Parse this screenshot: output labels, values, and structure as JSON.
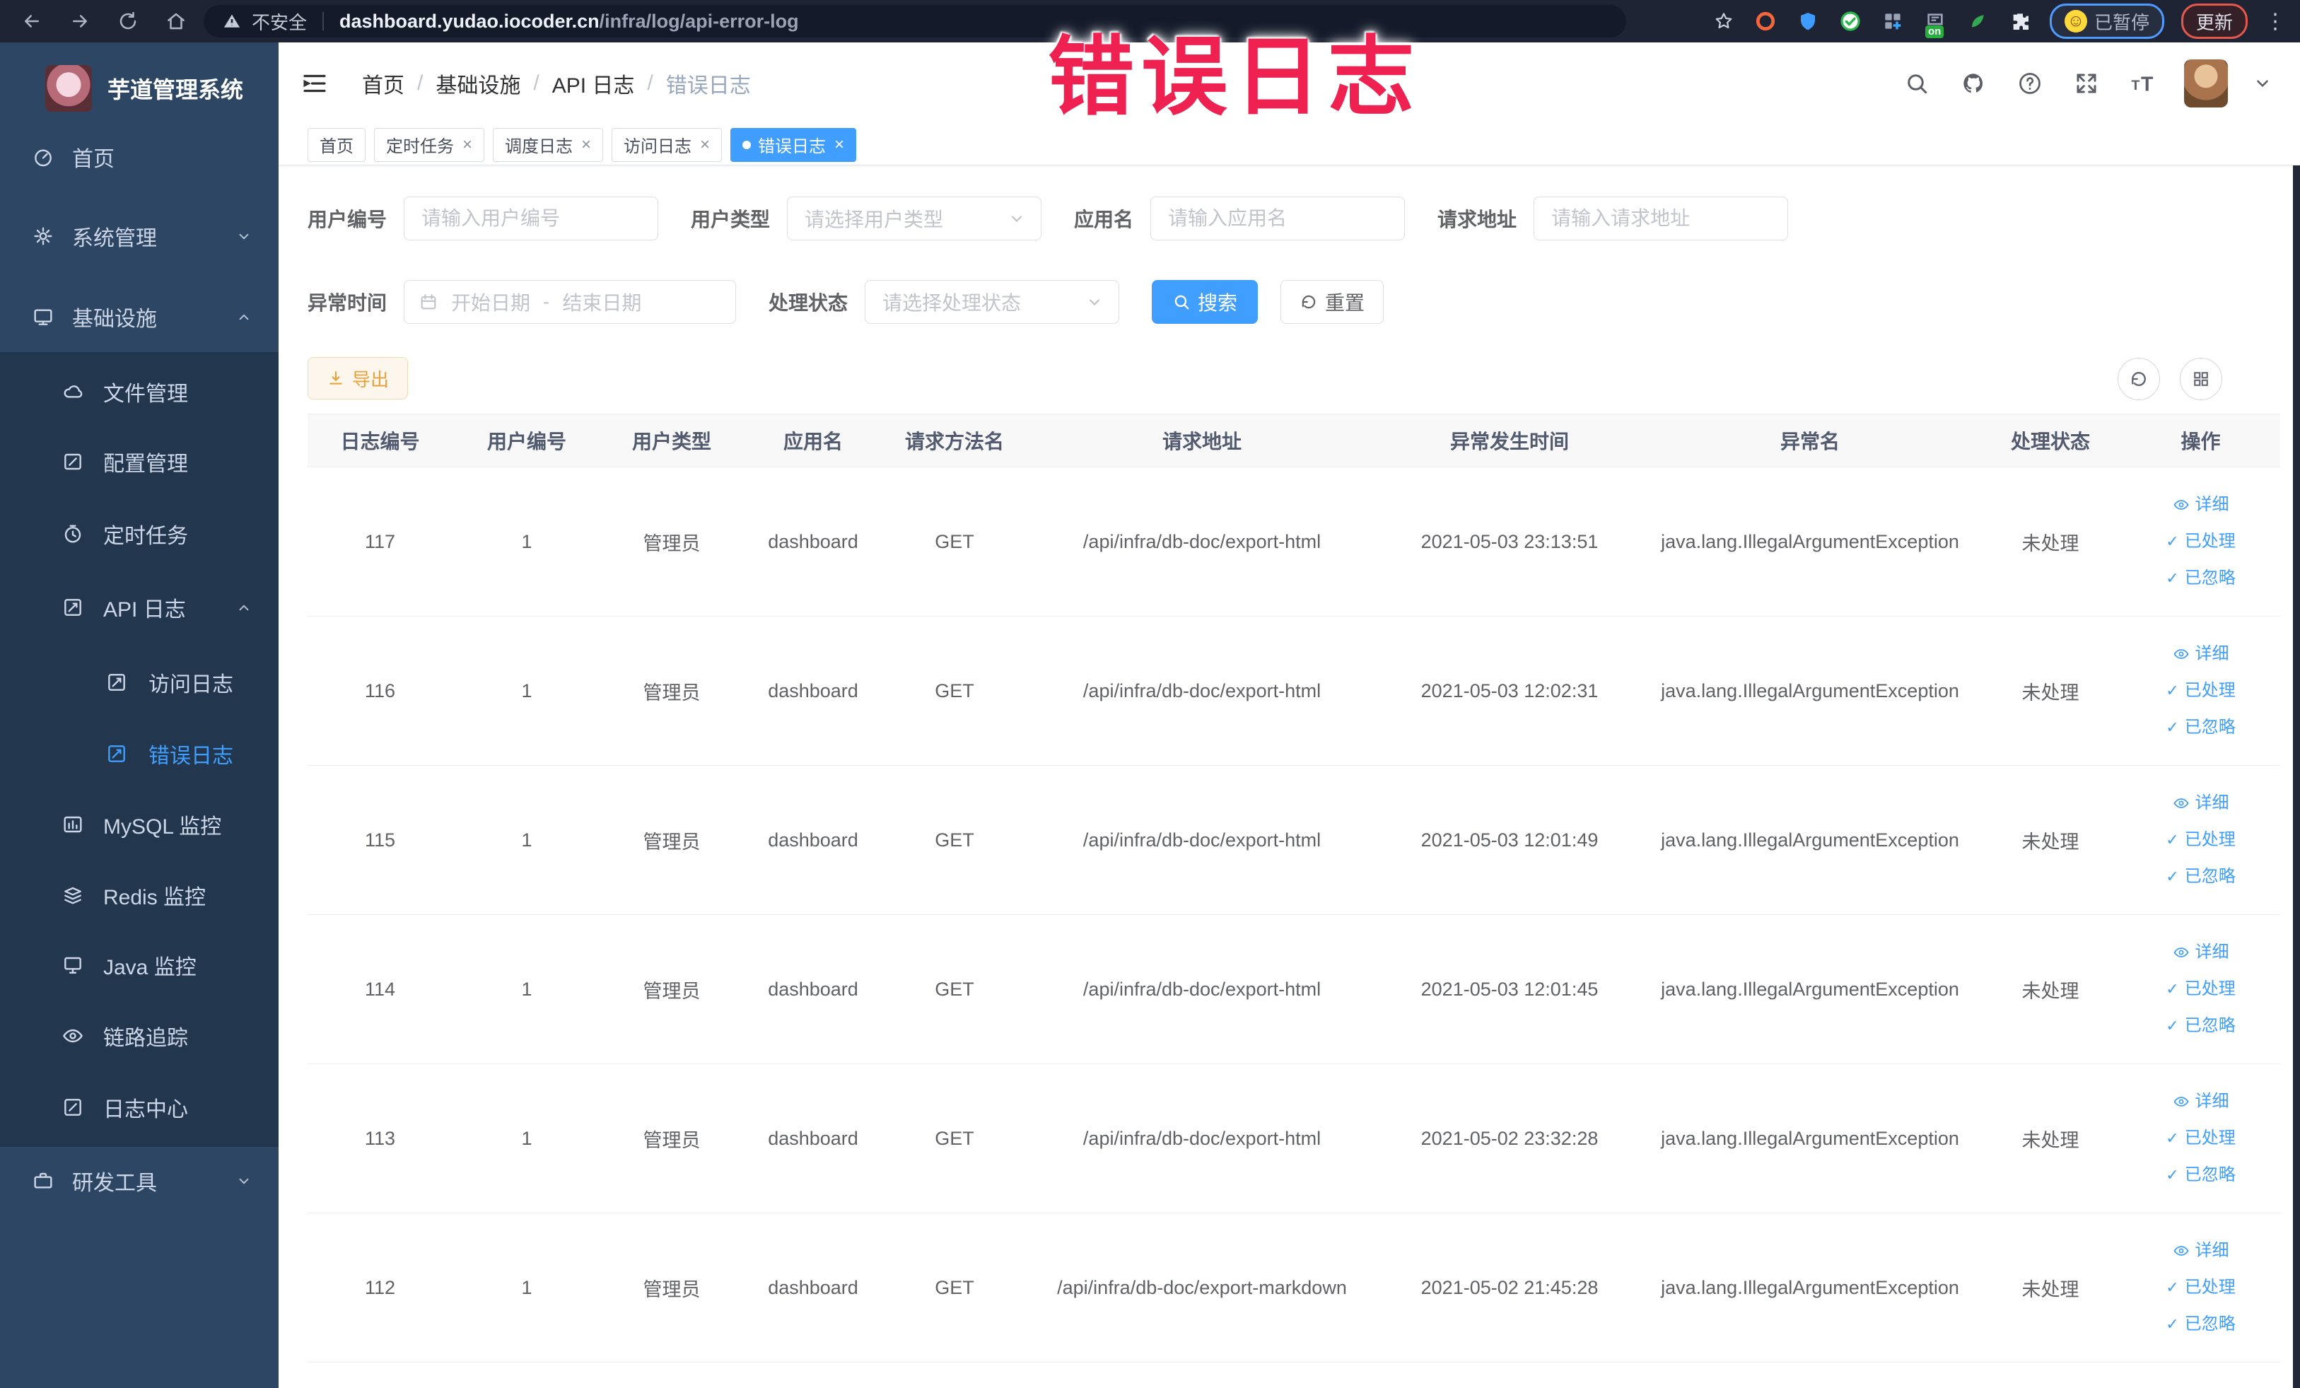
{
  "browser": {
    "security_label": "不安全",
    "url_host": "dashboard.yudao.iocoder.cn",
    "url_path": "/infra/log/api-error-log",
    "extension_on_badge": "on",
    "paused_label": "已暂停",
    "update_label": "更新"
  },
  "overlay": {
    "text": "错误日志",
    "color": "#ee2150"
  },
  "sidebar": {
    "title": "芋道管理系统",
    "items": [
      {
        "label": "首页",
        "icon": "home-icon",
        "level": 0
      },
      {
        "label": "系统管理",
        "icon": "gear-icon",
        "level": 0,
        "chevron": "down"
      },
      {
        "label": "基础设施",
        "icon": "infra-icon",
        "level": 0,
        "chevron": "up"
      },
      {
        "label": "文件管理",
        "icon": "cloud-file-icon",
        "level": 1
      },
      {
        "label": "配置管理",
        "icon": "config-icon",
        "level": 1
      },
      {
        "label": "定时任务",
        "icon": "timer-icon",
        "level": 1
      },
      {
        "label": "API 日志",
        "icon": "log-icon",
        "level": 1,
        "chevron": "up"
      },
      {
        "label": "访问日志",
        "icon": "log-icon",
        "level": 2
      },
      {
        "label": "错误日志",
        "icon": "log-icon",
        "level": 2,
        "active": true
      },
      {
        "label": "MySQL 监控",
        "icon": "mysql-icon",
        "level": 1
      },
      {
        "label": "Redis 监控",
        "icon": "redis-icon",
        "level": 1
      },
      {
        "label": "Java 监控",
        "icon": "java-icon",
        "level": 1
      },
      {
        "label": "链路追踪",
        "icon": "trace-icon",
        "level": 1
      },
      {
        "label": "日志中心",
        "icon": "log-center-icon",
        "level": 1
      },
      {
        "label": "研发工具",
        "icon": "tools-icon",
        "level": 0,
        "chevron": "down"
      }
    ]
  },
  "breadcrumb": [
    "首页",
    "基础设施",
    "API 日志",
    "错误日志"
  ],
  "tags": [
    {
      "label": "首页",
      "closable": false,
      "active": false
    },
    {
      "label": "定时任务",
      "closable": true,
      "active": false
    },
    {
      "label": "调度日志",
      "closable": true,
      "active": false
    },
    {
      "label": "访问日志",
      "closable": true,
      "active": false
    },
    {
      "label": "错误日志",
      "closable": true,
      "active": true
    }
  ],
  "filters": {
    "user_id_label": "用户编号",
    "user_id_placeholder": "请输入用户编号",
    "user_type_label": "用户类型",
    "user_type_placeholder": "请选择用户类型",
    "app_name_label": "应用名",
    "app_name_placeholder": "请输入应用名",
    "request_url_label": "请求地址",
    "request_url_placeholder": "请输入请求地址",
    "exception_time_label": "异常时间",
    "date_start_placeholder": "开始日期",
    "date_separator": "-",
    "date_end_placeholder": "结束日期",
    "process_status_label": "处理状态",
    "process_status_placeholder": "请选择处理状态",
    "search_label": "搜索",
    "reset_label": "重置"
  },
  "toolbar": {
    "export_label": "导出"
  },
  "table": {
    "columns": [
      "日志编号",
      "用户编号",
      "用户类型",
      "应用名",
      "请求方法名",
      "请求地址",
      "异常发生时间",
      "异常名",
      "处理状态",
      "操作"
    ],
    "action_labels": [
      "详细",
      "已处理",
      "已忽略"
    ],
    "rows": [
      {
        "log_id": "117",
        "user_id": "1",
        "user_type": "管理员",
        "app_name": "dashboard",
        "method": "GET",
        "request_url": "/api/infra/db-doc/export-html",
        "time": "2021-05-03 23:13:51",
        "exception": "java.lang.IllegalArgumentException",
        "status": "未处理"
      },
      {
        "log_id": "116",
        "user_id": "1",
        "user_type": "管理员",
        "app_name": "dashboard",
        "method": "GET",
        "request_url": "/api/infra/db-doc/export-html",
        "time": "2021-05-03 12:02:31",
        "exception": "java.lang.IllegalArgumentException",
        "status": "未处理"
      },
      {
        "log_id": "115",
        "user_id": "1",
        "user_type": "管理员",
        "app_name": "dashboard",
        "method": "GET",
        "request_url": "/api/infra/db-doc/export-html",
        "time": "2021-05-03 12:01:49",
        "exception": "java.lang.IllegalArgumentException",
        "status": "未处理"
      },
      {
        "log_id": "114",
        "user_id": "1",
        "user_type": "管理员",
        "app_name": "dashboard",
        "method": "GET",
        "request_url": "/api/infra/db-doc/export-html",
        "time": "2021-05-03 12:01:45",
        "exception": "java.lang.IllegalArgumentException",
        "status": "未处理"
      },
      {
        "log_id": "113",
        "user_id": "1",
        "user_type": "管理员",
        "app_name": "dashboard",
        "method": "GET",
        "request_url": "/api/infra/db-doc/export-html",
        "time": "2021-05-02 23:32:28",
        "exception": "java.lang.IllegalArgumentException",
        "status": "未处理"
      },
      {
        "log_id": "112",
        "user_id": "1",
        "user_type": "管理员",
        "app_name": "dashboard",
        "method": "GET",
        "request_url": "/api/infra/db-doc/export-markdown",
        "time": "2021-05-02 21:45:28",
        "exception": "java.lang.IllegalArgumentException",
        "status": "未处理"
      }
    ]
  },
  "icons": {
    "search": "magnifier",
    "github": "octocat",
    "help": "question-circle",
    "fullscreen": "expand-arrows",
    "font_size": "double-T",
    "refresh": "circular-arrow",
    "columns": "grid",
    "export": "download-arrow",
    "detail": "eye",
    "done": "check"
  },
  "colors": {
    "accent": "#409eff",
    "overlay_red": "#ee2150",
    "export_text": "#e6a23c",
    "sidebar_bg": "#2d4664",
    "submenu_bg": "#22374e",
    "chrome_bg": "#1e2433"
  }
}
